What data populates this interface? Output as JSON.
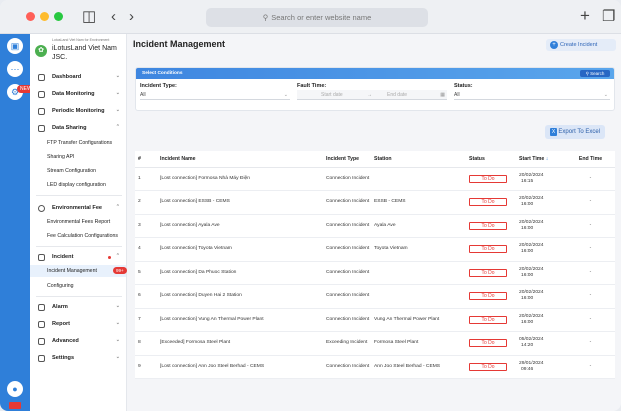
{
  "browser": {
    "url_placeholder": "Search or enter website name",
    "traffic_lights": [
      "#ff5f57",
      "#febc2e",
      "#28c840"
    ]
  },
  "rail": {
    "badge": "NEW"
  },
  "org": {
    "tagline": "LotusLand Viet Nam for Environment",
    "name": "iLotusLand Viet Nam JSC."
  },
  "sidebar": {
    "dashboard": "Dashboard",
    "data_monitoring": "Data Monitoring",
    "periodic_monitoring": "Periodic Monitoring",
    "data_sharing": "Data Sharing",
    "ftp": "FTP Transfer Configurations",
    "sharing_api": "Sharing API",
    "stream": "Stream Configuration",
    "led": "LED display configuration",
    "env_fee": "Environmental Fee",
    "env_fee_report": "Environmental Fees Report",
    "fee_calc": "Fee Calculation Configurations",
    "incident": "Incident",
    "incident_mgmt": "Incident Management",
    "incident_badge": "99+",
    "configuring": "Configuring",
    "alarm": "Alarm",
    "report": "Report",
    "advanced": "Advanced",
    "settings": "Settings"
  },
  "main": {
    "title": "Incident Management",
    "create_label": "Create Incident",
    "conditions_title": "Select Conditions",
    "search_label": "Search",
    "incident_type_label": "Incident Type:",
    "incident_type_value": "All",
    "fault_time_label": "Fault Time:",
    "start_date_placeholder": "Start date",
    "end_date_placeholder": "End date",
    "status_label": "Status:",
    "status_value": "All",
    "export_label": "Export To Excel"
  },
  "table": {
    "headers": [
      "#",
      "Incident Name",
      "Incident Type",
      "Station",
      "Status",
      "Start Time",
      "End Time"
    ],
    "rows": [
      {
        "n": "1",
        "name": "[Lost connection] Formosa Nhà Máy Điện",
        "type": "Connection Incident",
        "station": "",
        "status": "To Do",
        "date": "20/02/2024",
        "time": "16:15",
        "end": "-"
      },
      {
        "n": "2",
        "name": "[Lost connection] ESSB - CEMS",
        "type": "Connection Incident",
        "station": "ESSB - CEMS",
        "status": "To Do",
        "date": "20/02/2024",
        "time": "16:00",
        "end": "-"
      },
      {
        "n": "3",
        "name": "[Lost connection] Ayala Ave",
        "type": "Connection Incident",
        "station": "Ayala Ave",
        "status": "To Do",
        "date": "20/02/2024",
        "time": "16:00",
        "end": "-"
      },
      {
        "n": "4",
        "name": "[Lost connection] Toyota Vietnam",
        "type": "Connection Incident",
        "station": "Toyota Vietnam",
        "status": "To Do",
        "date": "20/02/2024",
        "time": "16:00",
        "end": "-"
      },
      {
        "n": "5",
        "name": "[Lost connection] Da Phuoc Station",
        "type": "Connection Incident",
        "station": "",
        "status": "To Do",
        "date": "20/02/2024",
        "time": "16:00",
        "end": "-"
      },
      {
        "n": "6",
        "name": "[Lost connection] Duyen Hai 2 Station",
        "type": "Connection Incident",
        "station": "",
        "status": "To Do",
        "date": "20/02/2024",
        "time": "16:00",
        "end": "-"
      },
      {
        "n": "7",
        "name": "[Lost connection] Vung An Thermal Power Plant",
        "type": "Connection Incident",
        "station": "Vung An Thermal Power Plant",
        "status": "To Do",
        "date": "20/02/2024",
        "time": "16:00",
        "end": "-"
      },
      {
        "n": "8",
        "name": "[Exceeded] Formosa Steel Plant",
        "type": "Exceeding Incident",
        "station": "Formosa Steel Plant",
        "status": "To Do",
        "date": "05/02/2024",
        "time": "14:20",
        "end": "-"
      },
      {
        "n": "9",
        "name": "[Lost connection] Ann Joo Steel Berhad - CEMS",
        "type": "Connection Incident",
        "station": "Ann Joo Steel Berhad - CEMS",
        "status": "To Do",
        "date": "29/01/2024",
        "time": "09:46",
        "end": "-"
      }
    ]
  }
}
